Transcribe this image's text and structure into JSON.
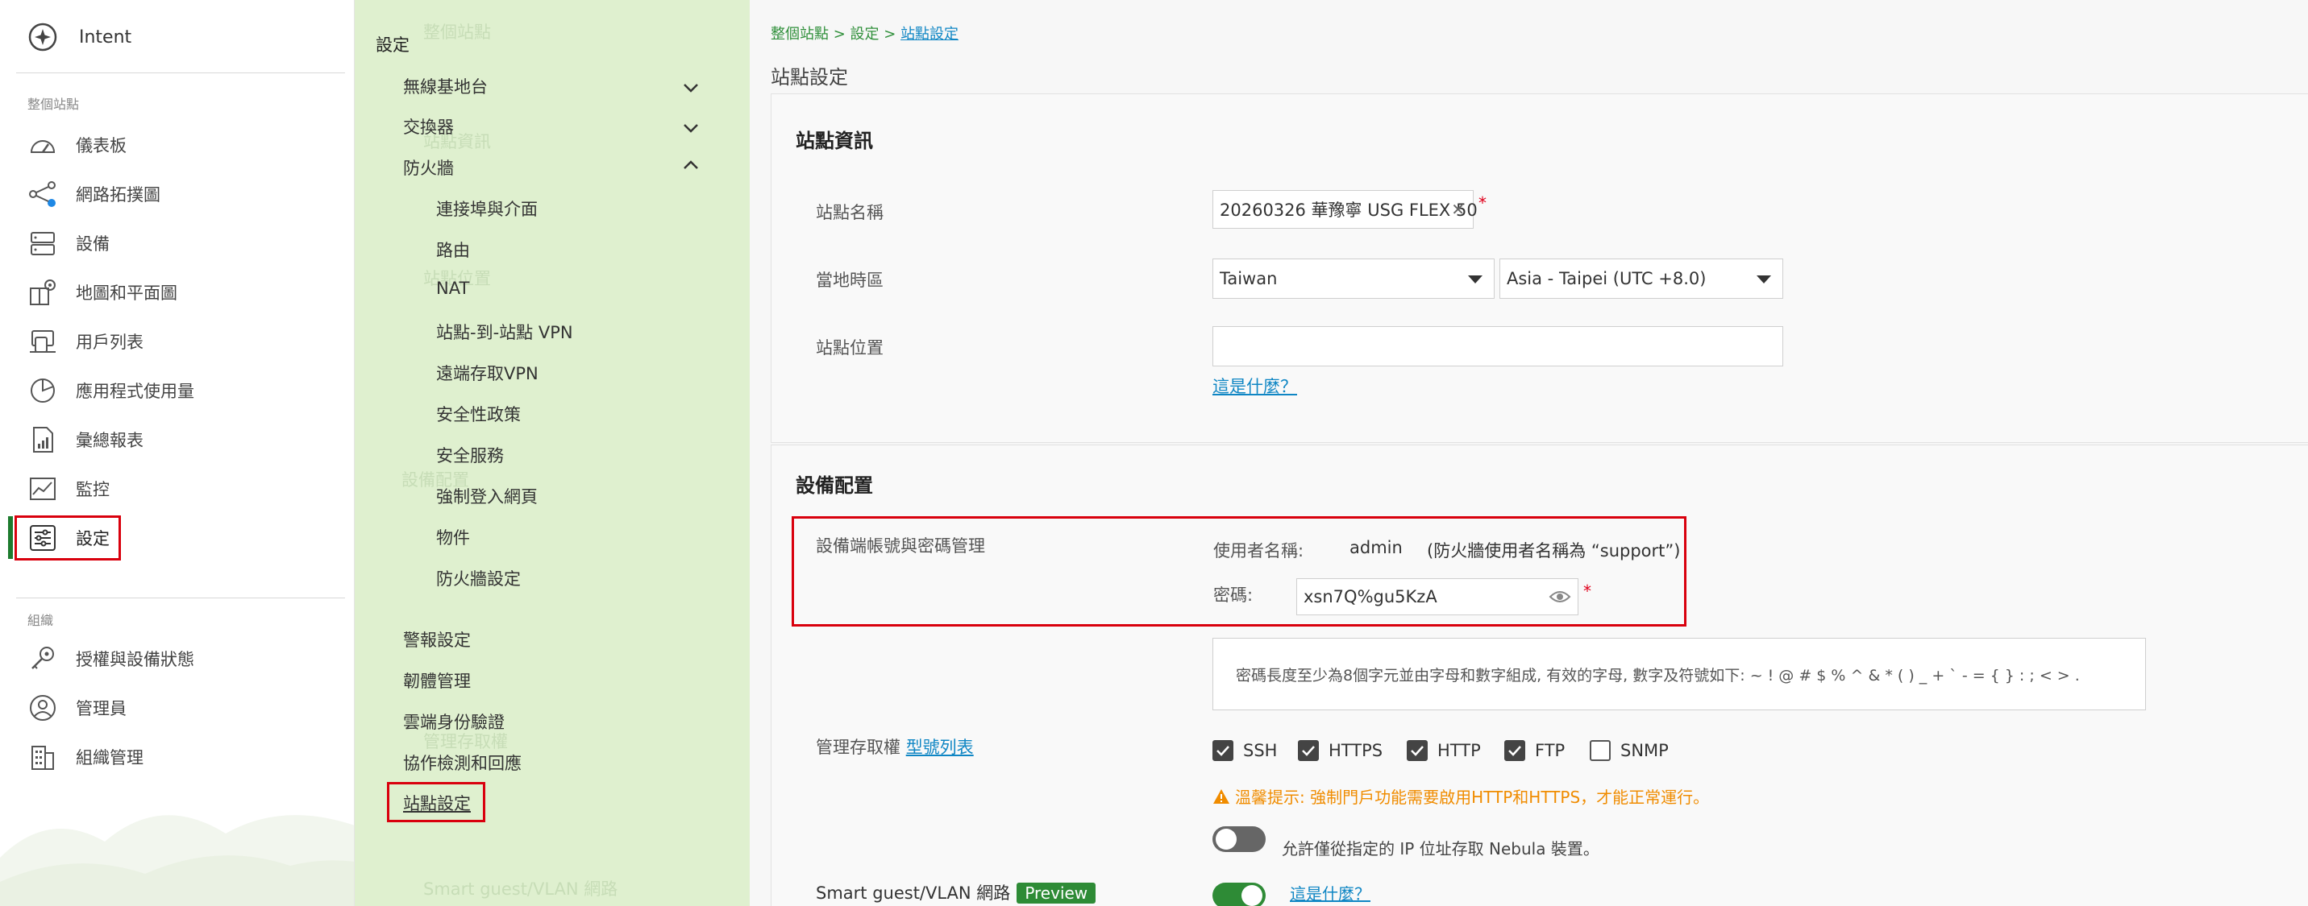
{
  "nav": {
    "brand": "Intent",
    "section_site": "整個站點",
    "items_site": [
      {
        "label": "儀表板",
        "icon": "dashboard-icon"
      },
      {
        "label": "網路拓撲圖",
        "icon": "topology-icon"
      },
      {
        "label": "設備",
        "icon": "devices-icon"
      },
      {
        "label": "地圖和平面圖",
        "icon": "map-floorplan-icon"
      },
      {
        "label": "用戶列表",
        "icon": "clients-icon"
      },
      {
        "label": "應用程式使用量",
        "icon": "app-usage-icon"
      },
      {
        "label": "彙總報表",
        "icon": "summary-report-icon"
      },
      {
        "label": "監控",
        "icon": "monitor-icon"
      },
      {
        "label": "設定",
        "icon": "settings-icon",
        "active": true
      }
    ],
    "section_org": "組織",
    "items_org": [
      {
        "label": "授權與設備狀態",
        "icon": "license-icon"
      },
      {
        "label": "管理員",
        "icon": "administrator-icon"
      },
      {
        "label": "組織管理",
        "icon": "organization-icon"
      }
    ]
  },
  "subnav": {
    "title": "設定",
    "groups": [
      {
        "label": "無線基地台",
        "expanded": false
      },
      {
        "label": "交換器",
        "expanded": false
      },
      {
        "label": "防火牆",
        "expanded": true
      }
    ],
    "firewall_items": [
      "連接埠與介面",
      "路由",
      "NAT",
      "站點-到-站點 VPN",
      "遠端存取VPN",
      "安全性政策",
      "安全服務",
      "強制登入網頁",
      "物件",
      "防火牆設定"
    ],
    "other_items": [
      "警報設定",
      "韌體管理",
      "雲端身份驗證",
      "協作檢測和回應",
      "站點設定"
    ],
    "ghost_texts": [
      "站點資訊",
      "站點位置",
      "設備配置",
      "管理存取權",
      "Smart guest/VLAN 網路",
      "Preview"
    ]
  },
  "main": {
    "breadcrumb": {
      "part1": "整個站點",
      "sep1": " > ",
      "part2": "設定",
      "sep2": " > ",
      "current": "站點設定"
    },
    "page_title": "站點設定",
    "site_info": {
      "title": "站點資訊",
      "name_label": "站點名稱",
      "name_value": "20260326 華豫寧 USG FLEX 50",
      "clear_symbol": "✕",
      "required_mark": "*",
      "tz_label": "當地時區",
      "tz_country": "Taiwan",
      "tz_zone": "Asia - Taipei (UTC +8.0)",
      "location_label": "站點位置",
      "location_value": "",
      "whatis_link": "這是什麼？"
    },
    "device_config": {
      "title": "設備配置",
      "cred_label": "設備端帳號與密碼管理",
      "username_label": "使用者名稱:",
      "username_value": "admin",
      "username_note": "(防火牆使用者名稱為 “support”)",
      "password_label": "密碼:",
      "password_value": "xsn7Q%gu5KzA",
      "required_mark": "*",
      "password_hint": "密碼長度至少為8個字元並由字母和數字組成, 有效的字母, 數字及符號如下: ~ ! @ # $ % ^ & * ( ) _ + ` - = { } : ; < > .",
      "access_label": "管理存取權",
      "access_link": "型號列表",
      "protocols": [
        {
          "label": "SSH",
          "checked": true
        },
        {
          "label": "HTTPS",
          "checked": true
        },
        {
          "label": "HTTP",
          "checked": true
        },
        {
          "label": "FTP",
          "checked": true
        },
        {
          "label": "SNMP",
          "checked": false
        }
      ],
      "warning_text": "溫馨提示: 強制門戶功能需要啟用HTTP和HTTPS，才能正常運行。",
      "ip_restrict_text": "允許僅從指定的 IP 位址存取 Nebula 裝置。",
      "ip_restrict_enabled": false,
      "vlan_label": "Smart guest/VLAN 網路",
      "vlan_badge": "Preview",
      "vlan_enabled": true,
      "vlan_link": "這是什麼？"
    }
  },
  "colors": {
    "accent_green": "#1d7b2e",
    "subnav_bg": "#dff0cf",
    "highlight_red": "#d9000d",
    "link_blue": "#0f86c4",
    "warning_orange": "#f08c00"
  }
}
